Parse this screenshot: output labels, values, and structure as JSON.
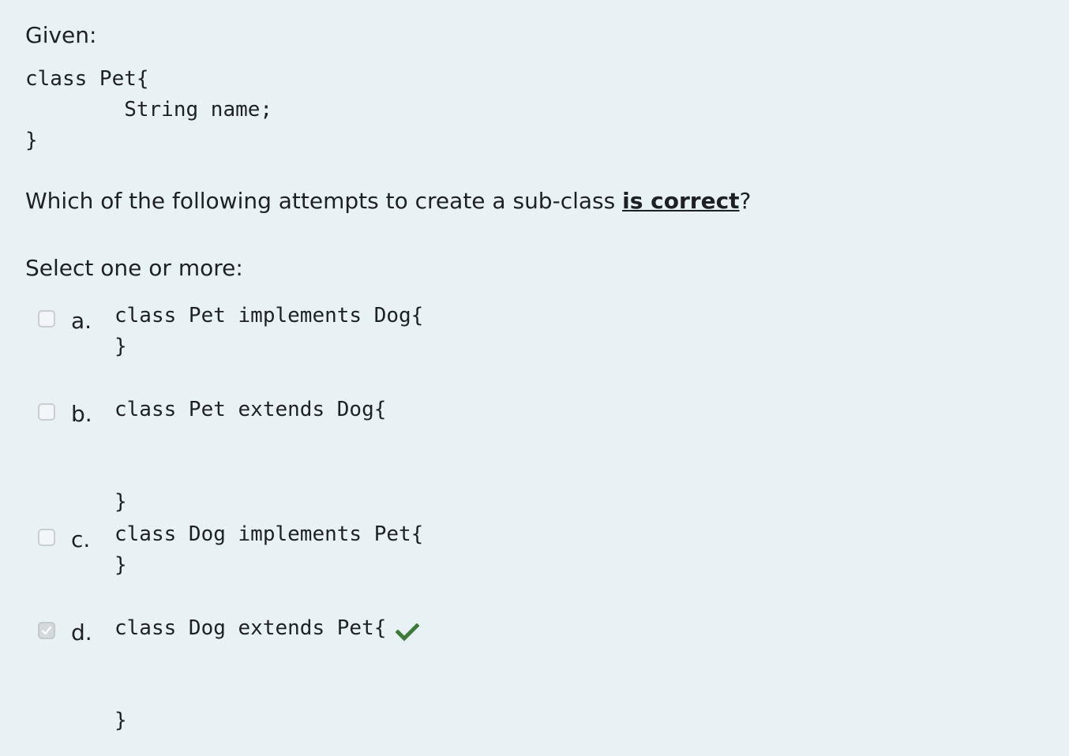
{
  "question": {
    "given_label": "Given:",
    "code_lines": [
      "class Pet{",
      "        String name;",
      "}"
    ],
    "prompt_before": "Which of the following attempts to create a sub-class ",
    "prompt_emphasis": "is correct",
    "prompt_after": "?",
    "select_label": "Select one or more:"
  },
  "options": [
    {
      "letter": "a.",
      "code": "class Pet implements Dog{\n}",
      "checked": false
    },
    {
      "letter": "b.",
      "code": "class Pet extends Dog{\n\n\n}",
      "checked": false
    },
    {
      "letter": "c.",
      "code": "class Dog implements Pet{\n}",
      "checked": false
    },
    {
      "letter": "d.",
      "code": "class Dog extends Pet{\n\n\n}",
      "checked": true,
      "feedback_icon": "correct-check-icon"
    }
  ],
  "colors": {
    "background": "#e8f2f4",
    "correct": "#3e7b3a",
    "text": "#1d2125"
  }
}
